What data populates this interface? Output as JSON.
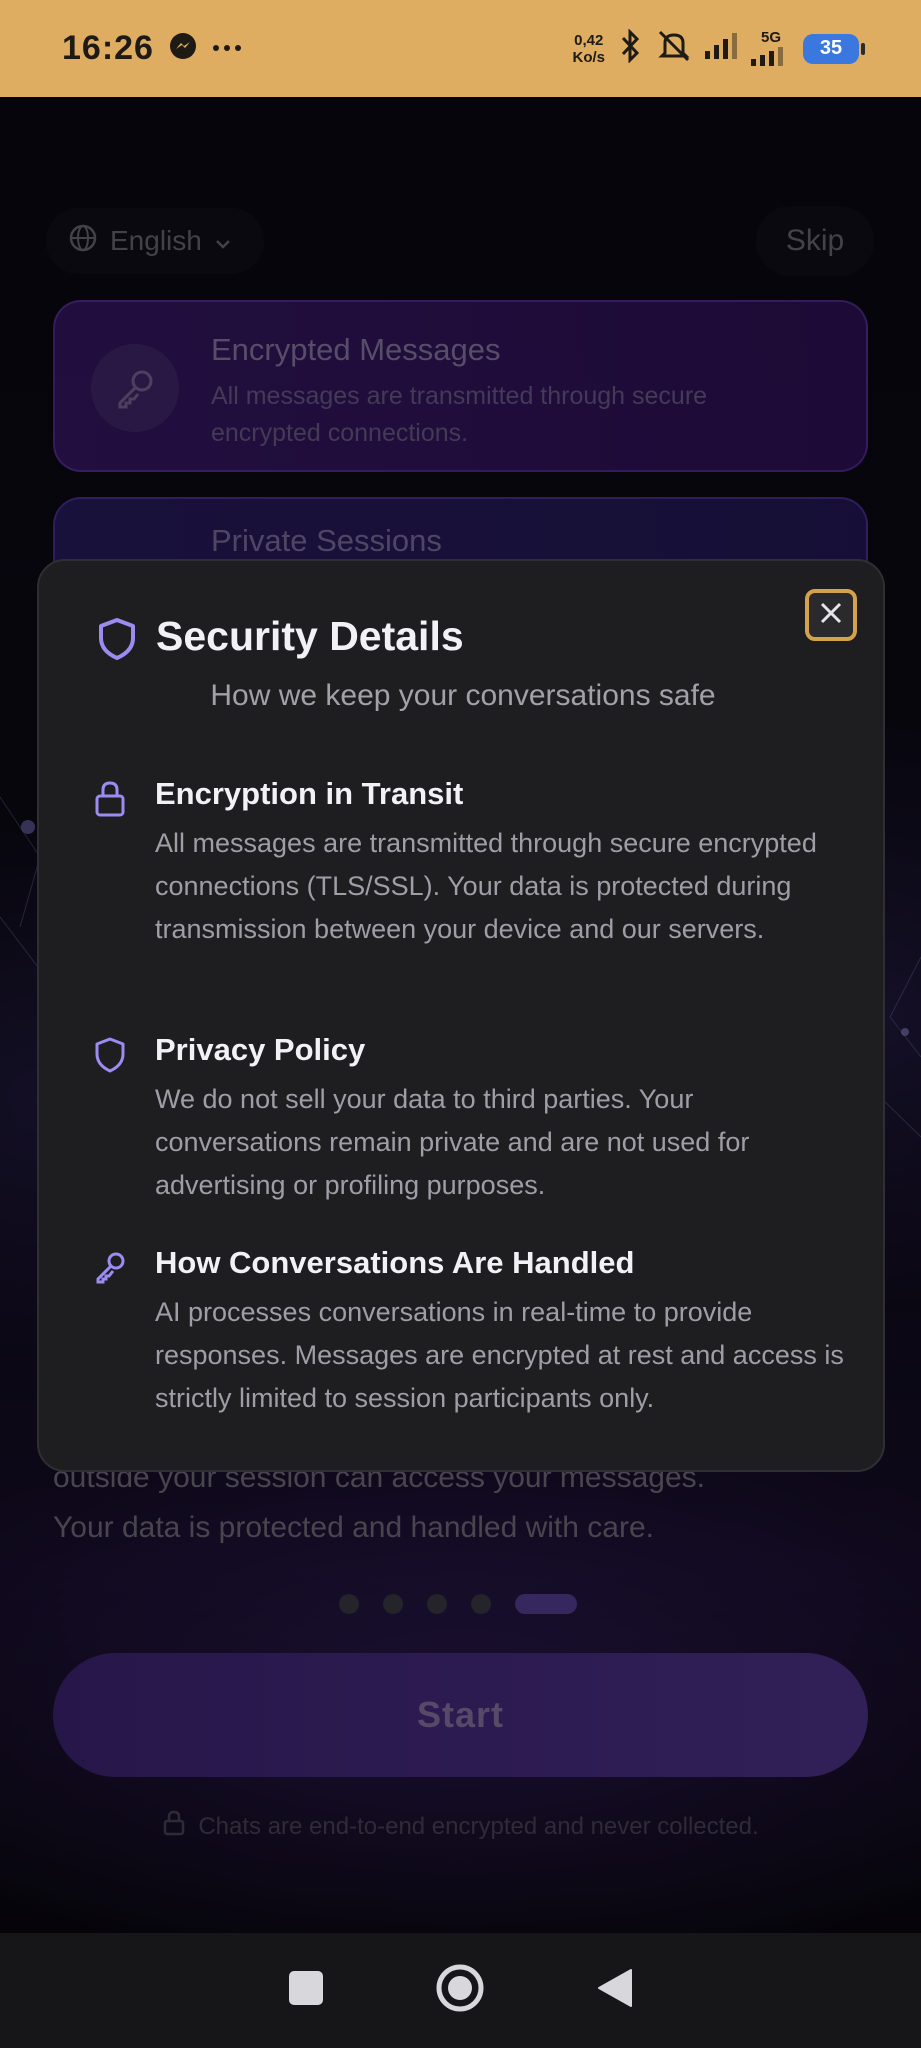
{
  "status_bar": {
    "time": "16:26",
    "network_speed_value": "0,42",
    "network_speed_unit": "Ko/s",
    "network_type": "5G",
    "battery": "35"
  },
  "background": {
    "language": "English",
    "skip": "Skip",
    "cards": [
      {
        "title": "Encrypted Messages",
        "description": "All messages are transmitted through secure encrypted connections."
      },
      {
        "title": "Private Sessions"
      }
    ],
    "body_line1": "outside your session can access your messages.",
    "body_line2": "Your data is protected and handled with care.",
    "pagination": {
      "total": 5,
      "active_index": 4
    },
    "start_button": "Start",
    "privacy_note": "Chats are end-to-end encrypted and never collected."
  },
  "modal": {
    "title": "Security Details",
    "subtitle": "How we keep your conversations safe",
    "sections": [
      {
        "icon": "lock-icon",
        "title": "Encryption in Transit",
        "body": "All messages are transmitted through secure encrypted connections (TLS/SSL). Your data is protected during transmission between your device and our servers."
      },
      {
        "icon": "shield-icon",
        "title": "Privacy Policy",
        "body": "We do not sell your data to third parties. Your conversations remain private and are not used for advertising or profiling purposes."
      },
      {
        "icon": "key-icon",
        "title": "How Conversations Are Handled",
        "body": "AI processes conversations in real-time to provide responses. Messages are encrypted at rest and access is strictly limited to session participants only."
      }
    ]
  },
  "colors": {
    "status_bar": "#dfad62",
    "accent_purple": "#9a8cf0",
    "close_border": "#d4a24a",
    "modal_bg": "#1e1e20"
  }
}
